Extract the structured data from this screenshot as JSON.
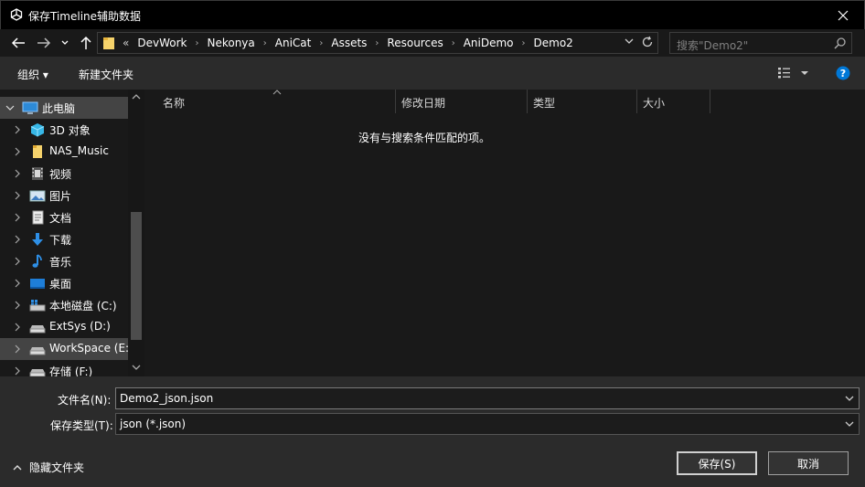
{
  "window": {
    "title": "保存Timeline辅助数据",
    "app_icon": "unity-icon",
    "close_icon": "close-icon"
  },
  "address": {
    "overflow": "«",
    "breadcrumbs": [
      "DevWork",
      "Nekonya",
      "AniCat",
      "Assets",
      "Resources",
      "AniDemo",
      "Demo2"
    ],
    "search_placeholder": "搜索\"Demo2\""
  },
  "toolbar": {
    "organize": "组织 ▾",
    "new_folder": "新建文件夹",
    "view_icon": "view-options-icon",
    "help_icon": "help-icon"
  },
  "nav": {
    "items": [
      {
        "label": "此电脑",
        "icon": "computer-icon",
        "expanded": true
      },
      {
        "label": "3D 对象",
        "icon": "3d-objects-icon"
      },
      {
        "label": "NAS_Music",
        "icon": "folder-icon"
      },
      {
        "label": "视频",
        "icon": "videos-icon"
      },
      {
        "label": "图片",
        "icon": "pictures-icon"
      },
      {
        "label": "文档",
        "icon": "documents-icon"
      },
      {
        "label": "下载",
        "icon": "downloads-icon"
      },
      {
        "label": "音乐",
        "icon": "music-icon"
      },
      {
        "label": "桌面",
        "icon": "desktop-icon"
      },
      {
        "label": "本地磁盘 (C:)",
        "icon": "system-drive-icon"
      },
      {
        "label": "ExtSys (D:)",
        "icon": "drive-icon"
      },
      {
        "label": "WorkSpace (E:",
        "icon": "drive-icon"
      },
      {
        "label": "存储 (F:)",
        "icon": "drive-icon"
      }
    ]
  },
  "files": {
    "columns": [
      "名称",
      "修改日期",
      "类型",
      "大小"
    ],
    "empty_message": "没有与搜索条件匹配的项。"
  },
  "form": {
    "filename_label": "文件名(N):",
    "filename_value": "Demo2_json.json",
    "filetype_label": "保存类型(T):",
    "filetype_value": "json (*.json)",
    "hide_folders": "隐藏文件夹",
    "save_button": "保存(S)",
    "cancel_button": "取消"
  },
  "colors": {
    "background": "#191919",
    "panel": "#2b2b2b",
    "selection": "#444444",
    "accent": "#0078d7"
  }
}
